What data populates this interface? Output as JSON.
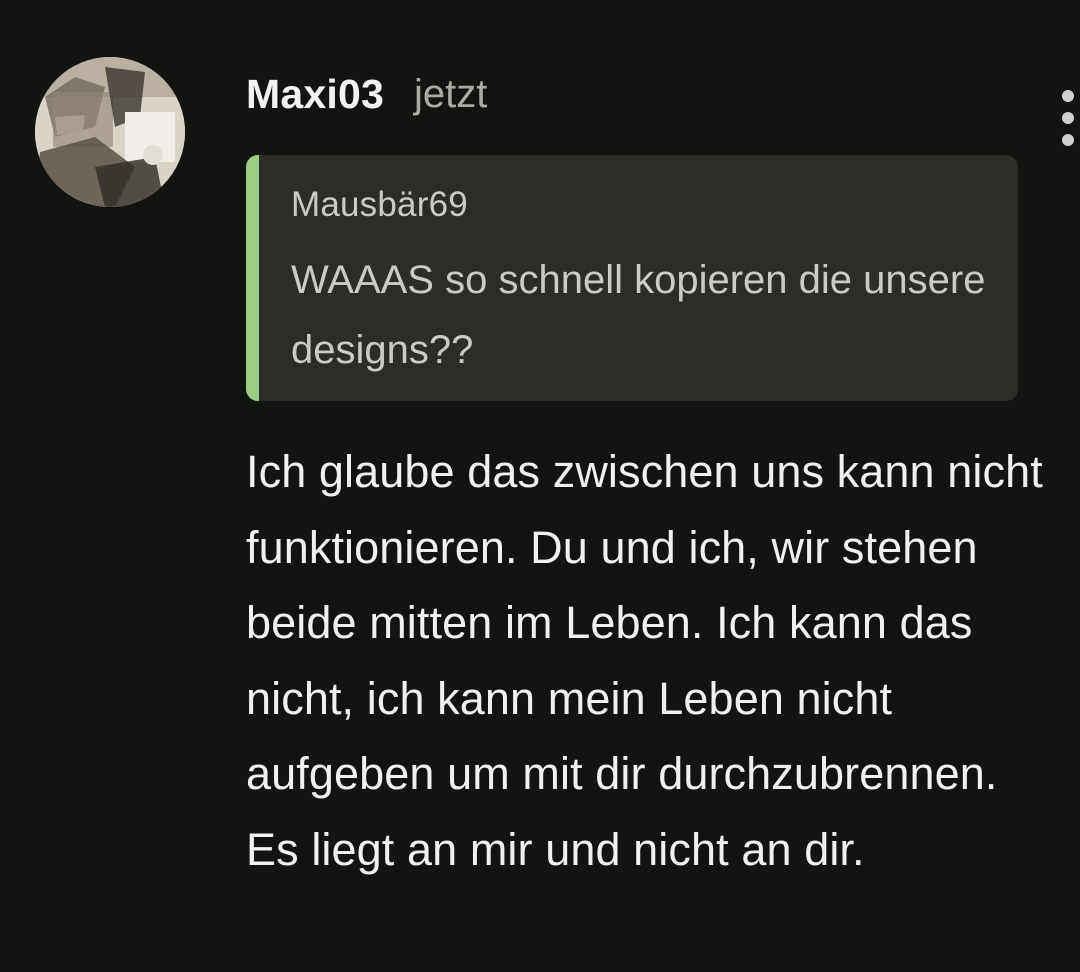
{
  "comment": {
    "author": "Maxi03",
    "timestamp": "jetzt",
    "more_icon": "more-vertical-icon",
    "avatar_icon": "avatar-photo",
    "quote": {
      "author": "Mausbär69",
      "text": "WAAAS so schnell kopieren die unsere designs??",
      "accent_color": "#9ccb84"
    },
    "body": "Ich glaube das zwischen uns kann nicht funktionieren. Du und ich, wir stehen beide mitten im Leben. Ich kann das nicht, ich kann mein Leben nicht aufgeben um mit dir durchzubrennen. Es liegt an mir und nicht an dir."
  },
  "colors": {
    "background": "#121411",
    "quote_background": "#2b2d29",
    "text_primary": "#f0f0f0",
    "text_secondary": "#a9aba6"
  }
}
